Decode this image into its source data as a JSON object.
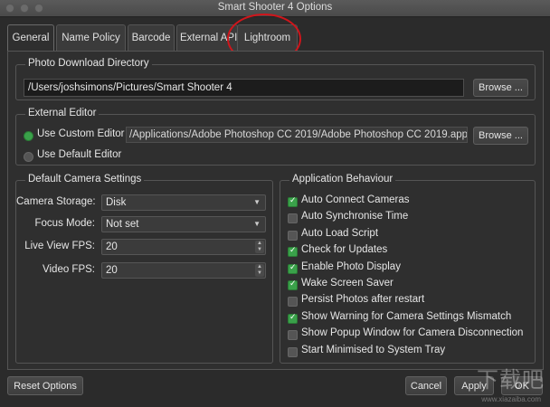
{
  "window": {
    "title": "Smart Shooter 4 Options"
  },
  "tabs": [
    {
      "label": "General",
      "active": true
    },
    {
      "label": "Name Policy",
      "active": false
    },
    {
      "label": "Barcode",
      "active": false
    },
    {
      "label": "External API",
      "active": false
    },
    {
      "label": "Lightroom",
      "active": false
    }
  ],
  "photo_download": {
    "title": "Photo Download Directory",
    "path": "/Users/joshsimons/Pictures/Smart Shooter 4",
    "browse_label": "Browse ..."
  },
  "external_editor": {
    "title": "External Editor",
    "use_custom_label": "Use Custom Editor",
    "use_custom_selected": true,
    "custom_path": "/Applications/Adobe Photoshop CC 2019/Adobe Photoshop CC 2019.app",
    "browse_label": "Browse ...",
    "use_default_label": "Use Default Editor"
  },
  "camera_settings": {
    "title": "Default Camera Settings",
    "storage_label": "Camera Storage:",
    "storage_value": "Disk",
    "focus_label": "Focus Mode:",
    "focus_value": "Not set",
    "liveview_label": "Live View FPS:",
    "liveview_value": "20",
    "video_label": "Video FPS:",
    "video_value": "20"
  },
  "app_behaviour": {
    "title": "Application Behaviour",
    "options": [
      {
        "label": "Auto Connect Cameras",
        "checked": true
      },
      {
        "label": "Auto Synchronise Time",
        "checked": false
      },
      {
        "label": "Auto Load Script",
        "checked": false
      },
      {
        "label": "Check for Updates",
        "checked": true
      },
      {
        "label": "Enable Photo Display",
        "checked": true
      },
      {
        "label": "Wake Screen Saver",
        "checked": true
      },
      {
        "label": "Persist Photos after restart",
        "checked": false
      },
      {
        "label": "Show Warning for Camera Settings Mismatch",
        "checked": true
      },
      {
        "label": "Show Popup Window for Camera Disconnection",
        "checked": false
      },
      {
        "label": "Start Minimised to System Tray",
        "checked": false
      }
    ]
  },
  "footer": {
    "reset_label": "Reset Options",
    "cancel_label": "Cancel",
    "apply_label": "Apply",
    "ok_label": "OK"
  },
  "watermark": {
    "text": "下载吧",
    "url": "www.xiazaiba.com"
  },
  "colors": {
    "accent_green": "#3aa14a",
    "highlight_red": "#d0151b",
    "background": "#2f2f2f"
  }
}
